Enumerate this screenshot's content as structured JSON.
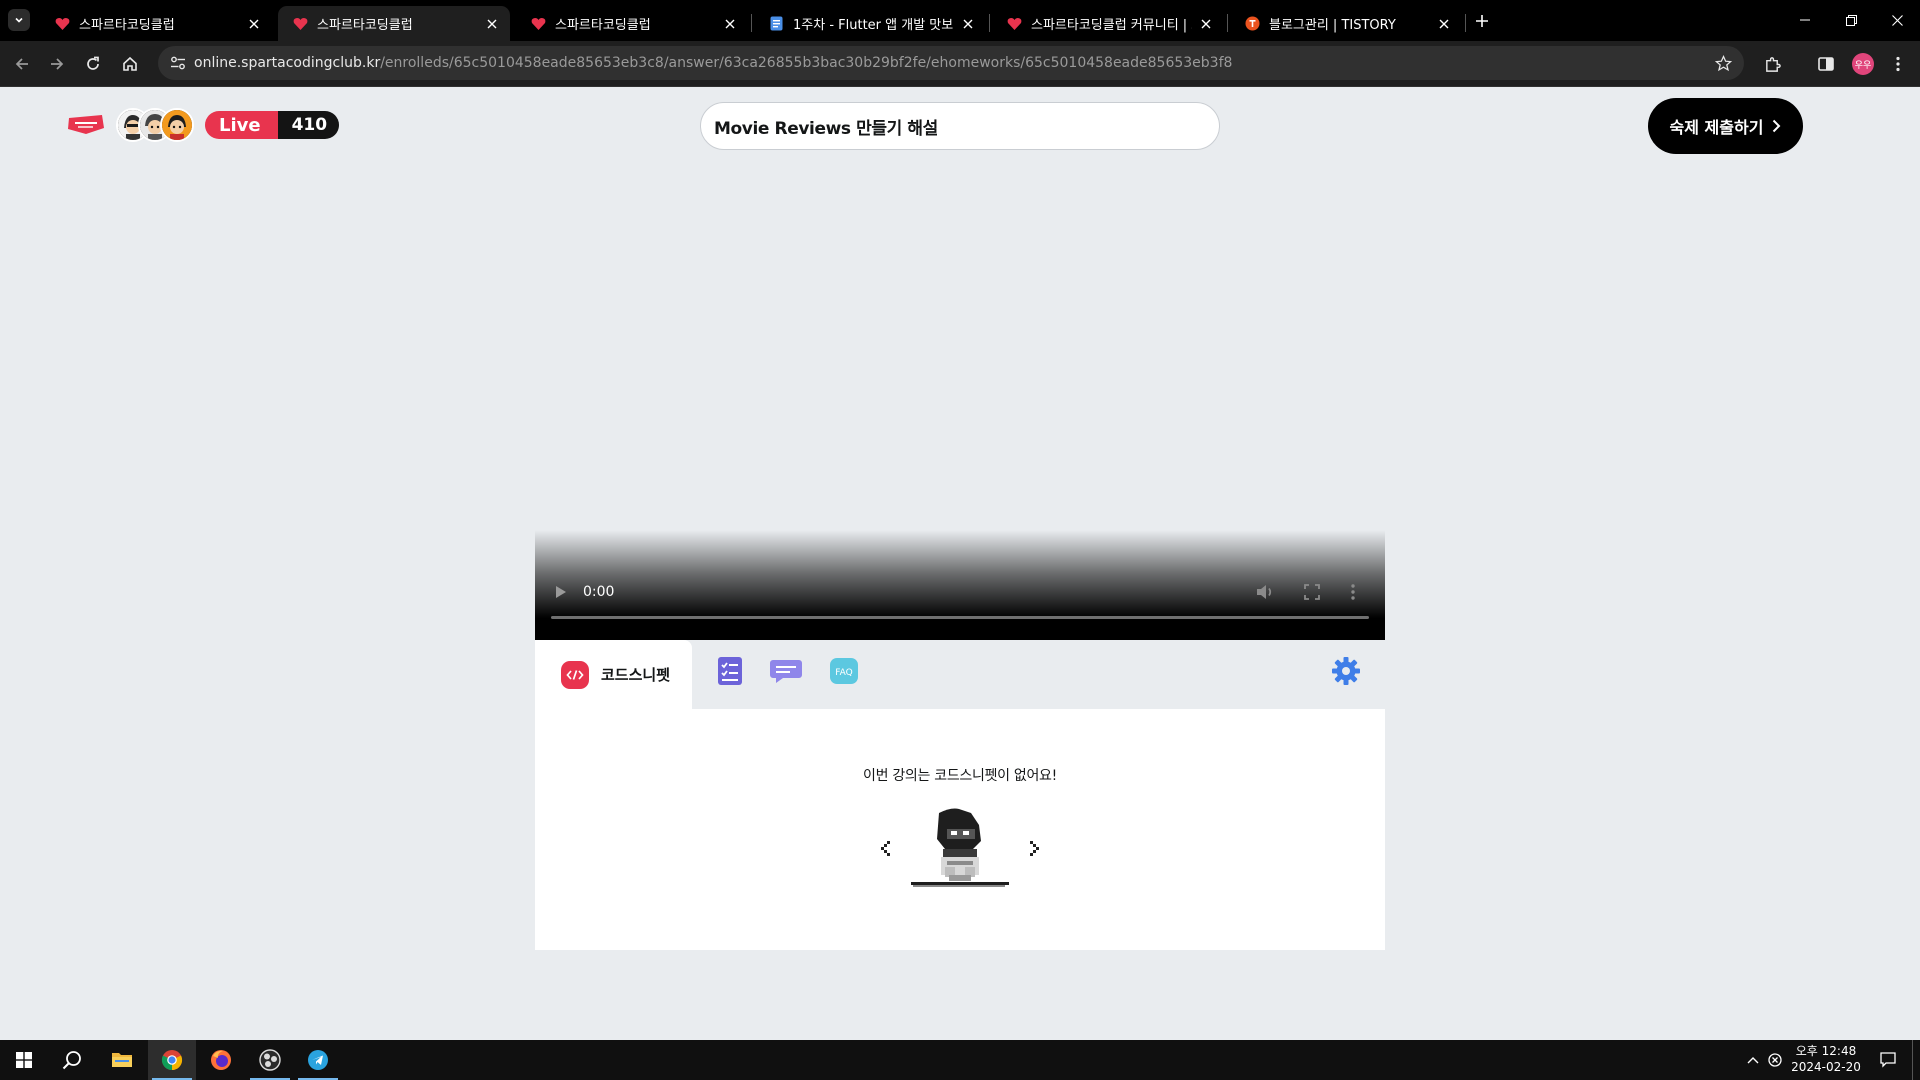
{
  "browser": {
    "tabs": [
      {
        "title": "스파르타코딩클럽",
        "favicon": "sparta-icon",
        "active": false
      },
      {
        "title": "스파르타코딩클럽",
        "favicon": "sparta-icon",
        "active": true
      },
      {
        "title": "스파르타코딩클럽",
        "favicon": "sparta-icon",
        "active": false
      },
      {
        "title": "1주차 - Flutter 앱 개발 맛보기",
        "favicon": "doc-icon",
        "active": false
      },
      {
        "title": "스파르타코딩클럽 커뮤니티 | 스",
        "favicon": "sparta-icon",
        "active": false
      },
      {
        "title": "블로그관리 | TISTORY",
        "favicon": "tistory-icon",
        "active": false
      }
    ],
    "url_host": "online.spartacodingclub.kr",
    "url_path": "/enrolleds/65c5010458eade85653eb3c8/answer/63ca26855b3bac30b29bf2fe/ehomeworks/65c5010458eade85653eb3f8",
    "profile_initials": "우우"
  },
  "header": {
    "live_label": "Live",
    "live_count": "410",
    "lesson_title": "Movie Reviews 만들기 해설",
    "submit_label": "숙제 제출하기"
  },
  "video": {
    "time": "0:00",
    "progress": 0
  },
  "tabs": {
    "snippet_label": "코드스니펫",
    "faq_label": "FAQ"
  },
  "panel": {
    "empty_message": "이번 강의는 코드스니펫이 없어요!"
  },
  "taskbar": {
    "time": "오후 12:48",
    "date": "2024-02-20"
  },
  "colors": {
    "brand_red": "#e8344e",
    "tab_purple": "#6c63d9",
    "gear_blue": "#3f7ee8",
    "faq_teal": "#5cc8e0"
  }
}
